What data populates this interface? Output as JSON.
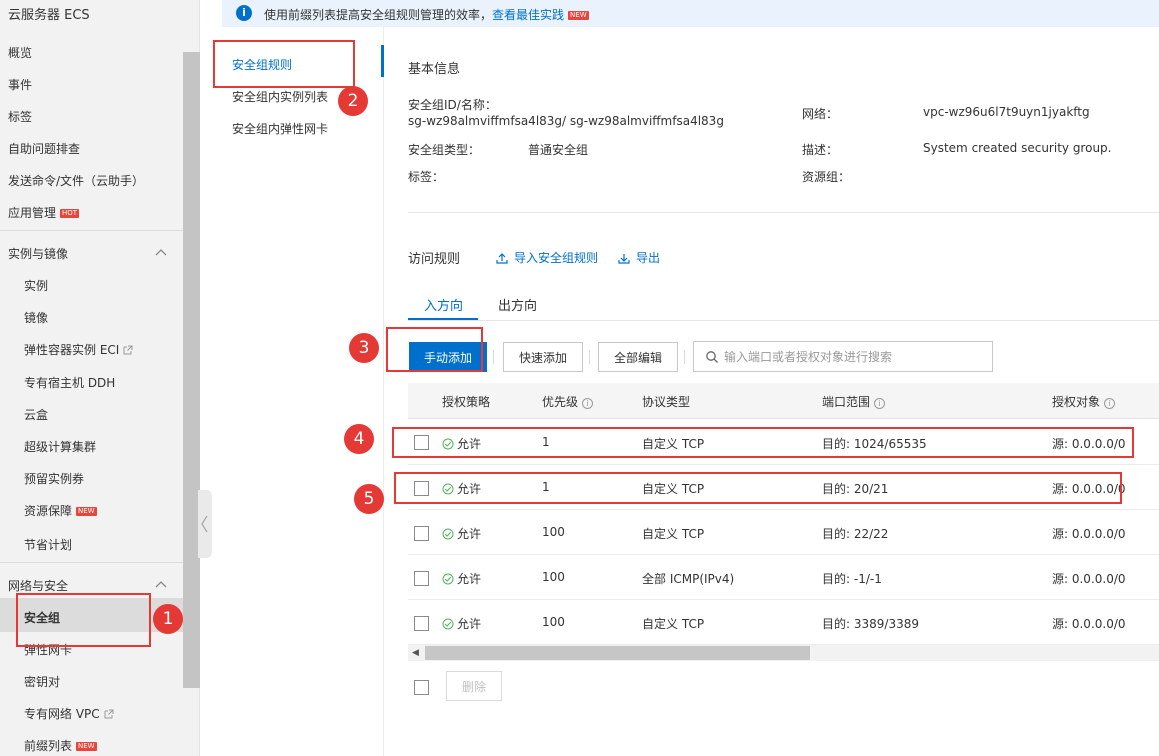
{
  "sidebar": {
    "title": "云服务器 ECS",
    "items": [
      {
        "label": "概览"
      },
      {
        "label": "事件"
      },
      {
        "label": "标签"
      },
      {
        "label": "自助问题排查"
      },
      {
        "label": "发送命令/文件（云助手）"
      },
      {
        "label": "应用管理",
        "badge": "HOT"
      }
    ],
    "group_instances": {
      "label": "实例与镜像",
      "items": [
        {
          "label": "实例"
        },
        {
          "label": "镜像"
        },
        {
          "label": "弹性容器实例 ECI"
        },
        {
          "label": "专有宿主机 DDH"
        },
        {
          "label": "云盒"
        },
        {
          "label": "超级计算集群"
        },
        {
          "label": "预留实例券"
        },
        {
          "label": "资源保障",
          "badge": "NEW"
        },
        {
          "label": "节省计划"
        }
      ]
    },
    "group_network": {
      "label": "网络与安全",
      "items": [
        {
          "label": "安全组"
        },
        {
          "label": "弹性网卡"
        },
        {
          "label": "密钥对"
        },
        {
          "label": "专有网络 VPC"
        },
        {
          "label": "前缀列表",
          "badge": "NEW"
        }
      ]
    }
  },
  "subnav": {
    "items": [
      {
        "label": "安全组规则"
      },
      {
        "label": "安全组内实例列表"
      },
      {
        "label": "安全组内弹性网卡"
      }
    ]
  },
  "banner": {
    "text": "使用前缀列表提高安全组规则管理的效率，",
    "link": "查看最佳实践",
    "badge": "NEW"
  },
  "basic_info": {
    "title": "基本信息",
    "sg_id_label": "安全组ID/名称：",
    "sg_id_value": "sg-wz98almviffmfsa4l83g/ sg-wz98almviffmfsa4l83g",
    "network_label": "网络：",
    "network_value": "vpc-wz96u6l7t9uyn1jyakftg",
    "type_label": "安全组类型：",
    "type_value": "普通安全组",
    "desc_label": "描述：",
    "desc_value": "System created security group.",
    "tag_label": "标签：",
    "rg_label": "资源组："
  },
  "access_rules": {
    "title": "访问规则",
    "import_label": "导入安全组规则",
    "export_label": "导出",
    "tabs": [
      "入方向",
      "出方向"
    ],
    "manual_add": "手动添加",
    "quick_add": "快速添加",
    "edit_all": "全部编辑",
    "search_placeholder": "输入端口或者授权对象进行搜索",
    "columns": [
      "授权策略",
      "优先级",
      "协议类型",
      "端口范围",
      "授权对象"
    ],
    "rows": [
      {
        "policy": "允许",
        "priority": "1",
        "protocol": "自定义 TCP",
        "port": "目的: 1024/65535",
        "source": "源: 0.0.0.0/0"
      },
      {
        "policy": "允许",
        "priority": "1",
        "protocol": "自定义 TCP",
        "port": "目的: 20/21",
        "source": "源: 0.0.0.0/0"
      },
      {
        "policy": "允许",
        "priority": "100",
        "protocol": "自定义 TCP",
        "port": "目的: 22/22",
        "source": "源: 0.0.0.0/0"
      },
      {
        "policy": "允许",
        "priority": "100",
        "protocol": "全部 ICMP(IPv4)",
        "port": "目的: -1/-1",
        "source": "源: 0.0.0.0/0"
      },
      {
        "policy": "允许",
        "priority": "100",
        "protocol": "自定义 TCP",
        "port": "目的: 3389/3389",
        "source": "源: 0.0.0.0/0"
      }
    ],
    "delete_label": "删除"
  },
  "annotations": [
    "1",
    "2",
    "3",
    "4",
    "5"
  ],
  "colors": {
    "accent": "#0070cc",
    "annotation": "#e53935",
    "allow": "#52b35a"
  }
}
